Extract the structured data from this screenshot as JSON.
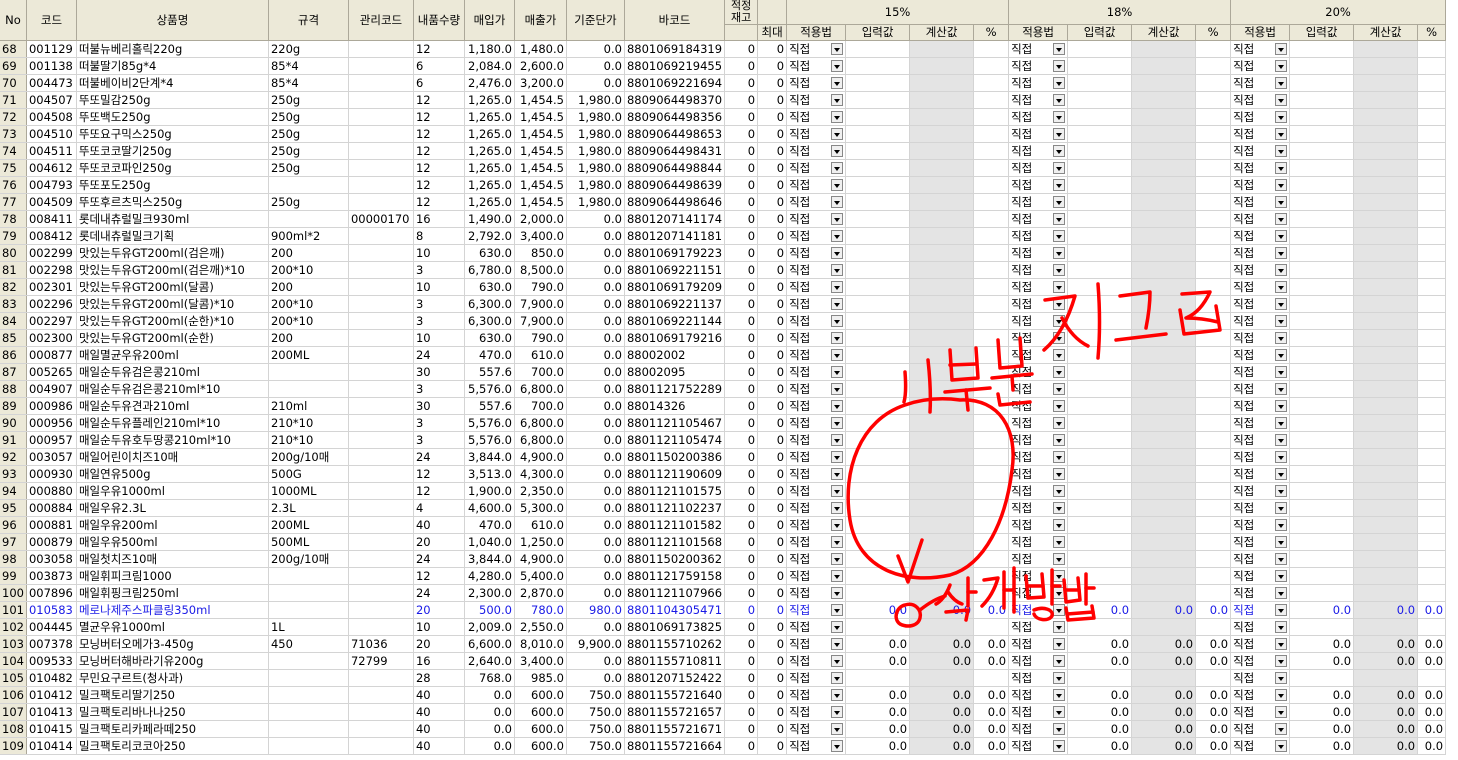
{
  "headers": {
    "no": "No",
    "code": "코드",
    "name": "상품명",
    "spec": "규격",
    "mgmt": "관리코드",
    "inqty": "내품수량",
    "buy": "매입가",
    "sell": "매출가",
    "base": "기준단가",
    "barcode": "바코드",
    "stock": "적정\n재고",
    "max": "최대",
    "groups": [
      "15%",
      "18%",
      "20%"
    ],
    "sub": [
      "적용법",
      "입력값",
      "계산값",
      "%"
    ]
  },
  "method_label": "직접",
  "rows": [
    {
      "no": "68",
      "code": "001129",
      "name": "떠불뉴베리홀릭220g",
      "spec": "220g",
      "mgmt": "",
      "qty": "12",
      "buy": "1,180.0",
      "sell": "1,480.0",
      "base": "0.0",
      "barcode": "8801069184319",
      "stock": "0",
      "max": "0",
      "vals": null
    },
    {
      "no": "69",
      "code": "001138",
      "name": "떠불딸기85g*4",
      "spec": "85*4",
      "mgmt": "",
      "qty": "6",
      "buy": "2,084.0",
      "sell": "2,600.0",
      "base": "0.0",
      "barcode": "8801069219455",
      "stock": "0",
      "max": "0",
      "vals": null
    },
    {
      "no": "70",
      "code": "004473",
      "name": "떠불베이비2단계*4",
      "spec": "85*4",
      "mgmt": "",
      "qty": "6",
      "buy": "2,476.0",
      "sell": "3,200.0",
      "base": "0.0",
      "barcode": "8801069221694",
      "stock": "0",
      "max": "0",
      "vals": null
    },
    {
      "no": "71",
      "code": "004507",
      "name": "뚜또밀감250g",
      "spec": "250g",
      "mgmt": "",
      "qty": "12",
      "buy": "1,265.0",
      "sell": "1,454.5",
      "base": "1,980.0",
      "barcode": "8809064498370",
      "stock": "0",
      "max": "0",
      "vals": null
    },
    {
      "no": "72",
      "code": "004508",
      "name": "뚜또백도250g",
      "spec": "250g",
      "mgmt": "",
      "qty": "12",
      "buy": "1,265.0",
      "sell": "1,454.5",
      "base": "1,980.0",
      "barcode": "8809064498356",
      "stock": "0",
      "max": "0",
      "vals": null
    },
    {
      "no": "73",
      "code": "004510",
      "name": "뚜또요구믹스250g",
      "spec": "250g",
      "mgmt": "",
      "qty": "12",
      "buy": "1,265.0",
      "sell": "1,454.5",
      "base": "1,980.0",
      "barcode": "8809064498653",
      "stock": "0",
      "max": "0",
      "vals": null
    },
    {
      "no": "74",
      "code": "004511",
      "name": "뚜또코코딸기250g",
      "spec": "250g",
      "mgmt": "",
      "qty": "12",
      "buy": "1,265.0",
      "sell": "1,454.5",
      "base": "1,980.0",
      "barcode": "8809064498431",
      "stock": "0",
      "max": "0",
      "vals": null
    },
    {
      "no": "75",
      "code": "004612",
      "name": "뚜또코코파인250g",
      "spec": "250g",
      "mgmt": "",
      "qty": "12",
      "buy": "1,265.0",
      "sell": "1,454.5",
      "base": "1,980.0",
      "barcode": "8809064498844",
      "stock": "0",
      "max": "0",
      "vals": null
    },
    {
      "no": "76",
      "code": "004793",
      "name": "뚜또포도250g",
      "spec": "",
      "mgmt": "",
      "qty": "12",
      "buy": "1,265.0",
      "sell": "1,454.5",
      "base": "1,980.0",
      "barcode": "8809064498639",
      "stock": "0",
      "max": "0",
      "vals": null
    },
    {
      "no": "77",
      "code": "004509",
      "name": "뚜또후르츠믹스250g",
      "spec": "250g",
      "mgmt": "",
      "qty": "12",
      "buy": "1,265.0",
      "sell": "1,454.5",
      "base": "1,980.0",
      "barcode": "8809064498646",
      "stock": "0",
      "max": "0",
      "vals": null
    },
    {
      "no": "78",
      "code": "008411",
      "name": "롯데내츄럴밀크930ml",
      "spec": "",
      "mgmt": "00000170",
      "qty": "16",
      "buy": "1,490.0",
      "sell": "2,000.0",
      "base": "0.0",
      "barcode": "8801207141174",
      "stock": "0",
      "max": "0",
      "vals": null
    },
    {
      "no": "79",
      "code": "008412",
      "name": "롯데내츄럴밀크기획",
      "spec": "900ml*2",
      "mgmt": "",
      "qty": "8",
      "buy": "2,792.0",
      "sell": "3,400.0",
      "base": "0.0",
      "barcode": "8801207141181",
      "stock": "0",
      "max": "0",
      "vals": null
    },
    {
      "no": "80",
      "code": "002299",
      "name": "맛있는두유GT200ml(검은깨)",
      "spec": "200",
      "mgmt": "",
      "qty": "10",
      "buy": "630.0",
      "sell": "850.0",
      "base": "0.0",
      "barcode": "8801069179223",
      "stock": "0",
      "max": "0",
      "vals": null
    },
    {
      "no": "81",
      "code": "002298",
      "name": "맛있는두유GT200ml(검은깨)*10",
      "spec": "200*10",
      "mgmt": "",
      "qty": "3",
      "buy": "6,780.0",
      "sell": "8,500.0",
      "base": "0.0",
      "barcode": "8801069221151",
      "stock": "0",
      "max": "0",
      "vals": null
    },
    {
      "no": "82",
      "code": "002301",
      "name": "맛있는두유GT200ml(달콤)",
      "spec": "200",
      "mgmt": "",
      "qty": "10",
      "buy": "630.0",
      "sell": "790.0",
      "base": "0.0",
      "barcode": "8801069179209",
      "stock": "0",
      "max": "0",
      "vals": null
    },
    {
      "no": "83",
      "code": "002296",
      "name": "맛있는두유GT200ml(달콤)*10",
      "spec": "200*10",
      "mgmt": "",
      "qty": "3",
      "buy": "6,300.0",
      "sell": "7,900.0",
      "base": "0.0",
      "barcode": "8801069221137",
      "stock": "0",
      "max": "0",
      "vals": null
    },
    {
      "no": "84",
      "code": "002297",
      "name": "맛있는두유GT200ml(순한)*10",
      "spec": "200*10",
      "mgmt": "",
      "qty": "3",
      "buy": "6,300.0",
      "sell": "7,900.0",
      "base": "0.0",
      "barcode": "8801069221144",
      "stock": "0",
      "max": "0",
      "vals": null
    },
    {
      "no": "85",
      "code": "002300",
      "name": "맛있는두유GT200ml(순한)",
      "spec": "200",
      "mgmt": "",
      "qty": "10",
      "buy": "630.0",
      "sell": "790.0",
      "base": "0.0",
      "barcode": "8801069179216",
      "stock": "0",
      "max": "0",
      "vals": null
    },
    {
      "no": "86",
      "code": "000877",
      "name": "매일멸균우유200ml",
      "spec": "200ML",
      "mgmt": "",
      "qty": "24",
      "buy": "470.0",
      "sell": "610.0",
      "base": "0.0",
      "barcode": "88002002",
      "stock": "0",
      "max": "0",
      "vals": null
    },
    {
      "no": "87",
      "code": "005265",
      "name": "매일순두유검은콩210ml",
      "spec": "",
      "mgmt": "",
      "qty": "30",
      "buy": "557.6",
      "sell": "700.0",
      "base": "0.0",
      "barcode": "88002095",
      "stock": "0",
      "max": "0",
      "vals": null
    },
    {
      "no": "88",
      "code": "004907",
      "name": "매일순두유검은콩210ml*10",
      "spec": "",
      "mgmt": "",
      "qty": "3",
      "buy": "5,576.0",
      "sell": "6,800.0",
      "base": "0.0",
      "barcode": "8801121752289",
      "stock": "0",
      "max": "0",
      "vals": null
    },
    {
      "no": "89",
      "code": "000986",
      "name": "매일순두유견과210ml",
      "spec": "210ml",
      "mgmt": "",
      "qty": "30",
      "buy": "557.6",
      "sell": "700.0",
      "base": "0.0",
      "barcode": "88014326",
      "stock": "0",
      "max": "0",
      "vals": null
    },
    {
      "no": "90",
      "code": "000956",
      "name": "매일순두유플레인210ml*10",
      "spec": "210*10",
      "mgmt": "",
      "qty": "3",
      "buy": "5,576.0",
      "sell": "6,800.0",
      "base": "0.0",
      "barcode": "8801121105467",
      "stock": "0",
      "max": "0",
      "vals": null
    },
    {
      "no": "91",
      "code": "000957",
      "name": "매일순두유호두땅콩210ml*10",
      "spec": "210*10",
      "mgmt": "",
      "qty": "3",
      "buy": "5,576.0",
      "sell": "6,800.0",
      "base": "0.0",
      "barcode": "8801121105474",
      "stock": "0",
      "max": "0",
      "vals": null
    },
    {
      "no": "92",
      "code": "003057",
      "name": "매일어린이치즈10매",
      "spec": "200g/10매",
      "mgmt": "",
      "qty": "24",
      "buy": "3,844.0",
      "sell": "4,900.0",
      "base": "0.0",
      "barcode": "8801150200386",
      "stock": "0",
      "max": "0",
      "vals": null
    },
    {
      "no": "93",
      "code": "000930",
      "name": "매일연유500g",
      "spec": "500G",
      "mgmt": "",
      "qty": "12",
      "buy": "3,513.0",
      "sell": "4,300.0",
      "base": "0.0",
      "barcode": "8801121190609",
      "stock": "0",
      "max": "0",
      "vals": null
    },
    {
      "no": "94",
      "code": "000880",
      "name": "매일우유1000ml",
      "spec": "1000ML",
      "mgmt": "",
      "qty": "12",
      "buy": "1,900.0",
      "sell": "2,350.0",
      "base": "0.0",
      "barcode": "8801121101575",
      "stock": "0",
      "max": "0",
      "vals": null
    },
    {
      "no": "95",
      "code": "000884",
      "name": "매일우유2.3L",
      "spec": "2.3L",
      "mgmt": "",
      "qty": "4",
      "buy": "4,600.0",
      "sell": "5,300.0",
      "base": "0.0",
      "barcode": "8801121102237",
      "stock": "0",
      "max": "0",
      "vals": null
    },
    {
      "no": "96",
      "code": "000881",
      "name": "매일우유200ml",
      "spec": "200ML",
      "mgmt": "",
      "qty": "40",
      "buy": "470.0",
      "sell": "610.0",
      "base": "0.0",
      "barcode": "8801121101582",
      "stock": "0",
      "max": "0",
      "vals": null
    },
    {
      "no": "97",
      "code": "000879",
      "name": "매일우유500ml",
      "spec": "500ML",
      "mgmt": "",
      "qty": "20",
      "buy": "1,040.0",
      "sell": "1,250.0",
      "base": "0.0",
      "barcode": "8801121101568",
      "stock": "0",
      "max": "0",
      "vals": null
    },
    {
      "no": "98",
      "code": "003058",
      "name": "매일첫치즈10매",
      "spec": "200g/10매",
      "mgmt": "",
      "qty": "24",
      "buy": "3,844.0",
      "sell": "4,900.0",
      "base": "0.0",
      "barcode": "8801150200362",
      "stock": "0",
      "max": "0",
      "vals": null
    },
    {
      "no": "99",
      "code": "003873",
      "name": "매일휘피크림1000",
      "spec": "",
      "mgmt": "",
      "qty": "12",
      "buy": "4,280.0",
      "sell": "5,400.0",
      "base": "0.0",
      "barcode": "8801121759158",
      "stock": "0",
      "max": "0",
      "vals": null
    },
    {
      "no": "100",
      "code": "007896",
      "name": "매일휘핑크림250ml",
      "spec": "",
      "mgmt": "",
      "qty": "24",
      "buy": "2,300.0",
      "sell": "2,870.0",
      "base": "0.0",
      "barcode": "8801121107966",
      "stock": "0",
      "max": "0",
      "vals": null
    },
    {
      "no": "101",
      "code": "010583",
      "name": "메로나제주스파클링350ml",
      "spec": "",
      "mgmt": "",
      "qty": "20",
      "buy": "500.0",
      "sell": "780.0",
      "base": "980.0",
      "barcode": "8801104305471",
      "stock": "0",
      "max": "0",
      "vals": "0.0",
      "hl": true
    },
    {
      "no": "102",
      "code": "004445",
      "name": "멸균우유1000ml",
      "spec": "1L",
      "mgmt": "",
      "qty": "10",
      "buy": "2,009.0",
      "sell": "2,550.0",
      "base": "0.0",
      "barcode": "8801069173825",
      "stock": "0",
      "max": "0",
      "vals": null
    },
    {
      "no": "103",
      "code": "007378",
      "name": "모닝버터오메가3-450g",
      "spec": "450",
      "mgmt": "71036",
      "qty": "20",
      "buy": "6,600.0",
      "sell": "8,010.0",
      "base": "9,900.0",
      "barcode": "8801155710262",
      "stock": "0",
      "max": "0",
      "vals": "0.0"
    },
    {
      "no": "104",
      "code": "009533",
      "name": "모닝버터해바라기유200g",
      "spec": "",
      "mgmt": "72799",
      "qty": "16",
      "buy": "2,640.0",
      "sell": "3,400.0",
      "base": "0.0",
      "barcode": "8801155710811",
      "stock": "0",
      "max": "0",
      "vals": "0.0"
    },
    {
      "no": "105",
      "code": "010482",
      "name": "무민요구르트(청사과)",
      "spec": "",
      "mgmt": "",
      "qty": "28",
      "buy": "768.0",
      "sell": "985.0",
      "base": "0.0",
      "barcode": "8801207152422",
      "stock": "0",
      "max": "0",
      "vals": null
    },
    {
      "no": "106",
      "code": "010412",
      "name": "밀크팩토리딸기250",
      "spec": "",
      "mgmt": "",
      "qty": "40",
      "buy": "0.0",
      "sell": "600.0",
      "base": "750.0",
      "barcode": "8801155721640",
      "stock": "0",
      "max": "0",
      "vals": "0.0"
    },
    {
      "no": "107",
      "code": "010413",
      "name": "밀크팩토리바나나250",
      "spec": "",
      "mgmt": "",
      "qty": "40",
      "buy": "0.0",
      "sell": "600.0",
      "base": "750.0",
      "barcode": "8801155721657",
      "stock": "0",
      "max": "0",
      "vals": "0.0"
    },
    {
      "no": "108",
      "code": "010415",
      "name": "밀크팩토리카페라떼250",
      "spec": "",
      "mgmt": "",
      "qty": "40",
      "buy": "0.0",
      "sell": "600.0",
      "base": "750.0",
      "barcode": "8801155721671",
      "stock": "0",
      "max": "0",
      "vals": "0.0"
    },
    {
      "no": "109",
      "code": "010414",
      "name": "밀크팩토리코코아250",
      "spec": "",
      "mgmt": "",
      "qty": "40",
      "buy": "0.0",
      "sell": "600.0",
      "base": "750.0",
      "barcode": "8801155721664",
      "stock": "0",
      "max": "0",
      "vals": "0.0"
    }
  ],
  "annotation": {
    "color": "#ff0000",
    "text_top": "이부분 지그림",
    "text_bottom": "삭제 방법"
  }
}
